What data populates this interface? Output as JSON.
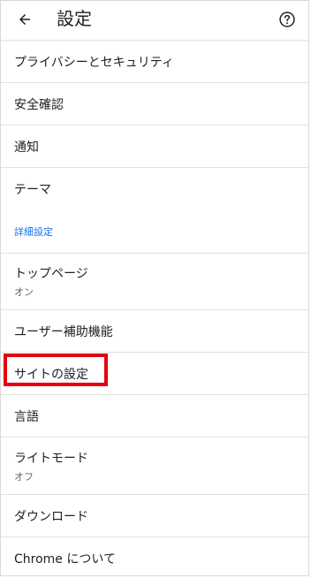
{
  "header": {
    "title": "設定"
  },
  "items": {
    "privacy": {
      "label": "プライバシーとセキュリティ"
    },
    "safety": {
      "label": "安全確認"
    },
    "notifications": {
      "label": "通知"
    },
    "theme": {
      "label": "テーマ"
    },
    "advanced_header": "詳細設定",
    "homepage": {
      "label": "トップページ",
      "sub": "オン"
    },
    "accessibility": {
      "label": "ユーザー補助機能"
    },
    "site_settings": {
      "label": "サイトの設定"
    },
    "languages": {
      "label": "言語"
    },
    "lite_mode": {
      "label": "ライトモード",
      "sub": "オフ"
    },
    "downloads": {
      "label": "ダウンロード"
    },
    "about": {
      "label": "Chrome について"
    }
  },
  "icons": {
    "back": "arrow-left-icon",
    "help": "help-circle-icon"
  },
  "colors": {
    "accent": "#1a73e8",
    "highlight": "#e3000f"
  }
}
